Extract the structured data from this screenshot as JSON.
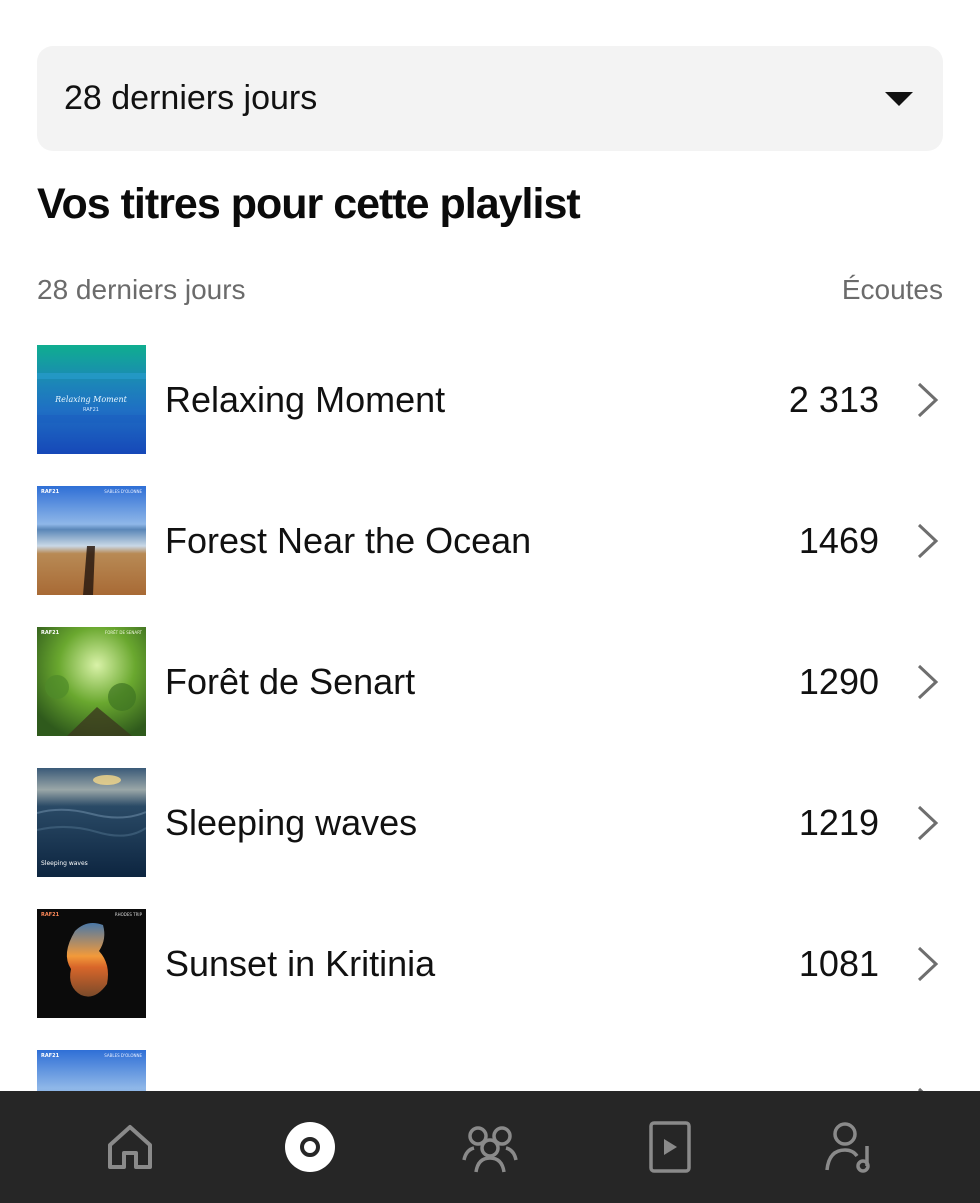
{
  "filter": {
    "label": "28 derniers jours"
  },
  "section": {
    "title": "Vos titres pour cette playlist"
  },
  "table": {
    "period_label": "28 derniers jours",
    "metric_label": "Écoutes"
  },
  "tracks": [
    {
      "title": "Relaxing Moment",
      "plays": "2 313",
      "cover": "relaxing-moment-cover",
      "cover_text": "Relaxing Moment",
      "cover_sub": "RAF21"
    },
    {
      "title": "Forest Near the Ocean",
      "plays": "1469",
      "cover": "beach-cover",
      "cover_text": "RAF21",
      "cover_sub": "SABLES D'OLONNE"
    },
    {
      "title": "Forêt de Senart",
      "plays": "1290",
      "cover": "forest-cover",
      "cover_text": "RAF21",
      "cover_sub": "FORÊT DE SENART"
    },
    {
      "title": "Sleeping waves",
      "plays": "1219",
      "cover": "waves-cover",
      "cover_text": "Sleeping waves",
      "cover_sub": ""
    },
    {
      "title": "Sunset in Kritinia",
      "plays": "1081",
      "cover": "sunset-cover",
      "cover_text": "RAF21",
      "cover_sub": "RHODES TRIP"
    },
    {
      "title": "",
      "plays": "",
      "cover": "beach-cover",
      "cover_text": "RAF21",
      "cover_sub": "SABLES D'OLONNE"
    }
  ],
  "nav": [
    "home-icon",
    "catalog-icon",
    "audience-icon",
    "video-icon",
    "artist-icon"
  ],
  "colors": {
    "bar_bg": "#262626",
    "nav_icon": "#8a8a8a",
    "nav_active": "#ffffff"
  }
}
